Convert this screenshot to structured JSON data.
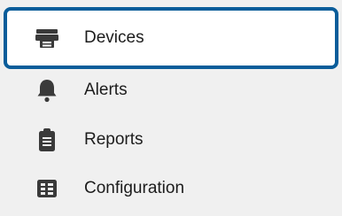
{
  "nav": {
    "items": [
      {
        "label": "Devices",
        "icon": "devices-icon",
        "selected": true
      },
      {
        "label": "Alerts",
        "icon": "bell-icon",
        "selected": false
      },
      {
        "label": "Reports",
        "icon": "clipboard-icon",
        "selected": false
      },
      {
        "label": "Configuration",
        "icon": "grid-icon",
        "selected": false
      }
    ],
    "selected_border_color": "#0a5d9a",
    "icon_color": "#3a3a3a"
  }
}
